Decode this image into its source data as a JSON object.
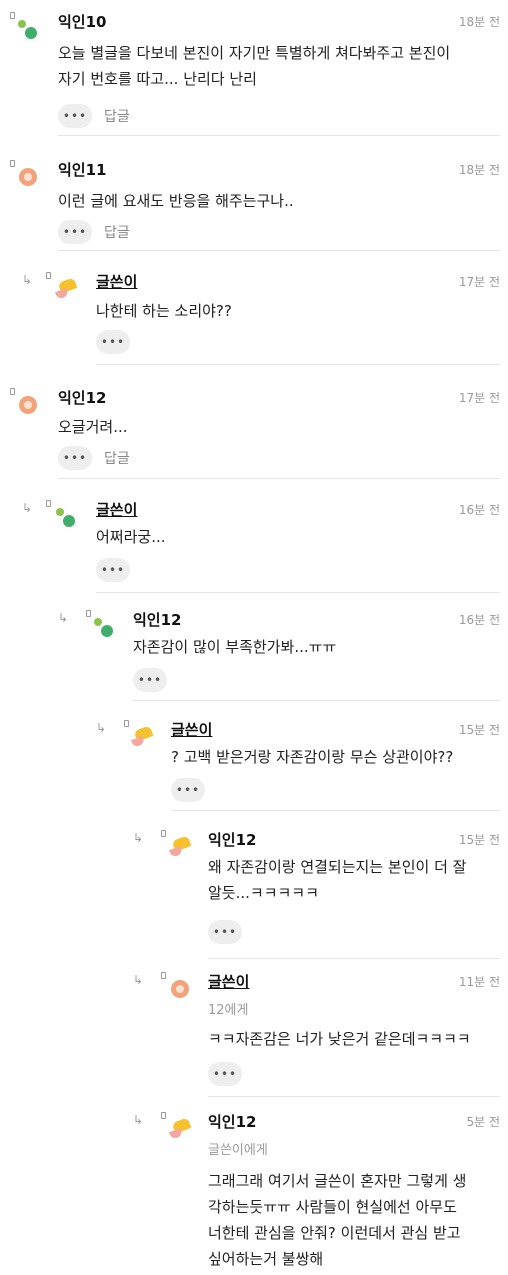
{
  "comments": [
    {
      "name": "익인10",
      "time": "18분 전",
      "lines": [
        "오늘 별글을 다보네 본진이 자기만 특별하게 쳐다봐주고 본진이",
        "자기 번호를 따고... 난리다 난리"
      ],
      "reply_label": "답글",
      "dots": "•••"
    },
    {
      "name": "익인11",
      "time": "18분 전",
      "lines": [
        "이런 글에 요새도 반응을 해주는구나.."
      ],
      "reply_label": "답글",
      "dots": "•••"
    },
    {
      "name": "글쓴이",
      "time": "17분 전",
      "lines": [
        "나한테 하는 소리야??"
      ],
      "dots": "•••"
    },
    {
      "name": "익인12",
      "time": "17분 전",
      "lines": [
        "오글거려..."
      ],
      "reply_label": "답글",
      "dots": "•••"
    },
    {
      "name": "글쓴이",
      "time": "16분 전",
      "lines": [
        "어쩌라궁..."
      ],
      "dots": "•••"
    },
    {
      "name": "익인12",
      "time": "16분 전",
      "lines": [
        "자존감이 많이 부족한가봐...ㅠㅠ"
      ],
      "dots": "•••"
    },
    {
      "name": "글쓴이",
      "time": "15분 전",
      "lines": [
        "? 고백 받은거랑 자존감이랑 무슨 상관이야??"
      ],
      "dots": "•••"
    },
    {
      "name": "익인12",
      "time": "15분 전",
      "lines": [
        "왜 자존감이랑 연결되는지는 본인이 더 잘",
        "알듯...ㅋㅋㅋㅋㅋ"
      ],
      "dots": "•••"
    },
    {
      "name": "글쓴이",
      "time": "11분 전",
      "mention": "12에게",
      "lines": [
        "ㅋㅋ자존감은 너가 낮은거 같은데ㅋㅋㅋㅋ"
      ],
      "dots": "•••"
    },
    {
      "name": "익인12",
      "time": "5분 전",
      "mention": "글쓴이에게",
      "lines": [
        "그래그래 여기서 글쓴이 혼자만 그렇게 생",
        "각하는듯ㅠㅠ 사람들이 현실에선 아무도",
        "너한테 관심을 안줘? 이런데서 관심 받고",
        "싶어하는거 불쌍해"
      ]
    }
  ]
}
